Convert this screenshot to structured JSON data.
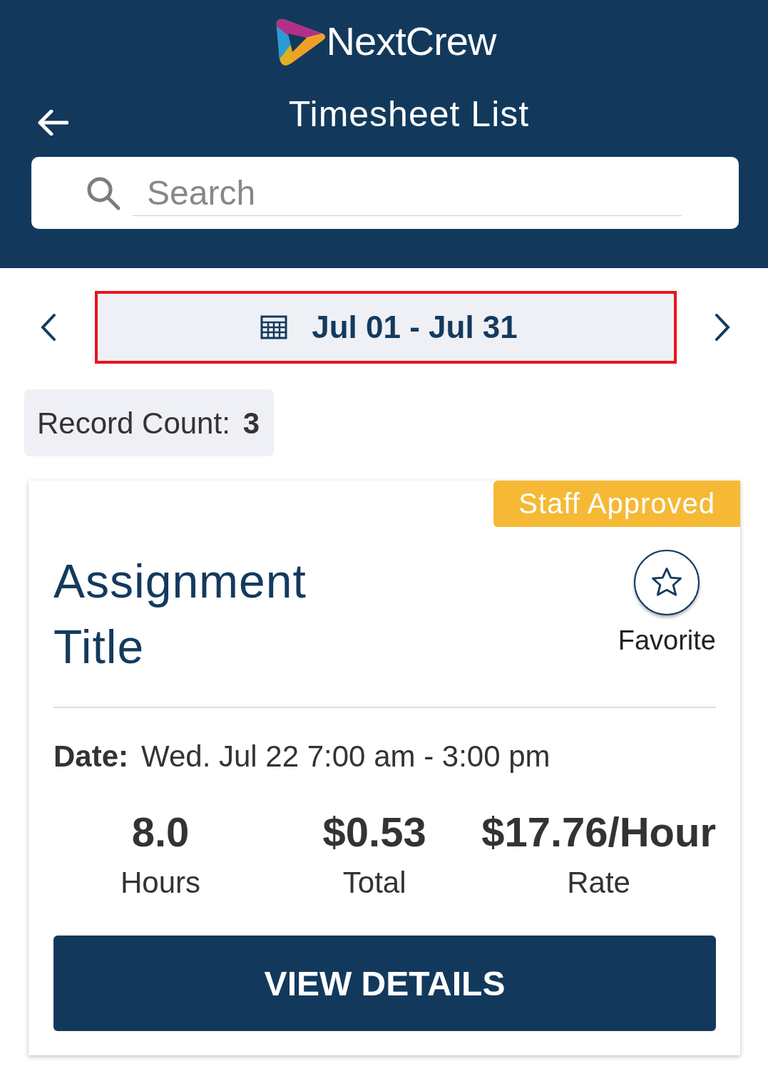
{
  "header": {
    "brand": "NextCrew",
    "title": "Timesheet List"
  },
  "search": {
    "placeholder": "Search"
  },
  "date_range": {
    "label": "Jul 01 - Jul 31",
    "highlighted": true
  },
  "record_count": {
    "label": "Record Count:",
    "value": "3"
  },
  "cards": [
    {
      "status": "Staff Approved",
      "title": "Assignment Title",
      "favorite": {
        "label": "Favorite",
        "selected": false
      },
      "date_label": "Date:",
      "date_value": "Wed. Jul 22 7:00 am - 3:00 pm",
      "stats": [
        {
          "value": "8.0",
          "label": "Hours"
        },
        {
          "value": "$0.53",
          "label": "Total"
        },
        {
          "value": "$17.76/Hour",
          "label": "Rate"
        }
      ],
      "button": "VIEW DETAILS"
    }
  ]
}
